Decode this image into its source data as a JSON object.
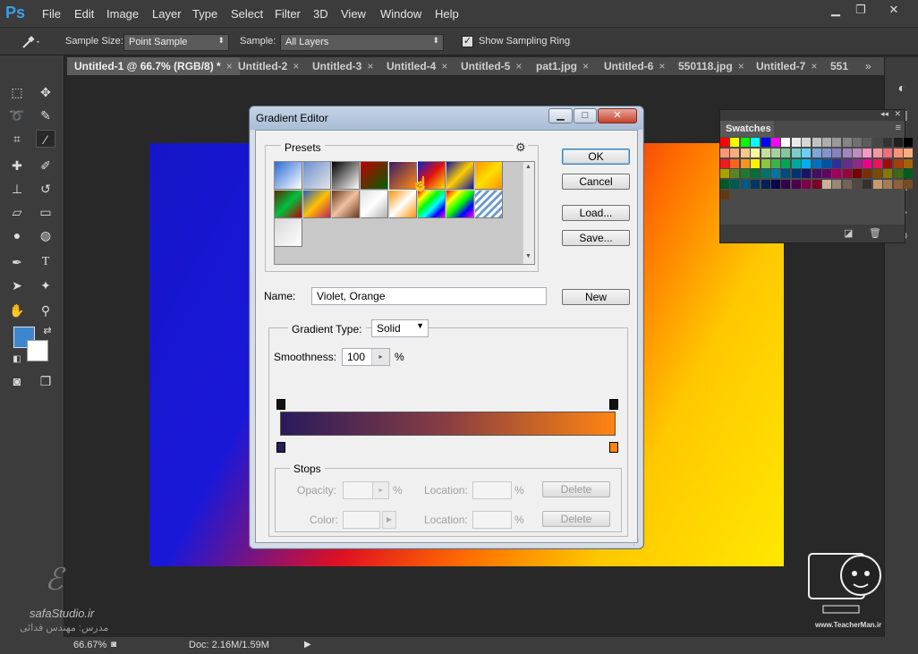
{
  "app": {
    "logo": "Ps"
  },
  "menu": [
    "File",
    "Edit",
    "Image",
    "Layer",
    "Type",
    "Select",
    "Filter",
    "3D",
    "View",
    "Window",
    "Help"
  ],
  "window_controls": {
    "minimize": "▁",
    "restore": "❐",
    "close": "✕"
  },
  "options": {
    "tool_icon": "eyedropper-icon",
    "sample_size_label": "Sample Size:",
    "sample_size_value": "Point Sample",
    "sample_label": "Sample:",
    "sample_value": "All Layers",
    "show_ring_label": "Show Sampling Ring",
    "show_ring_checked": true
  },
  "tabs": [
    {
      "label": "Untitled-1 @ 66.7% (RGB/8) *",
      "close": "×"
    },
    {
      "label": "Untitled-2",
      "close": "×"
    },
    {
      "label": "Untitled-3",
      "close": "×"
    },
    {
      "label": "Untitled-4",
      "close": "×"
    },
    {
      "label": "Untitled-5",
      "close": "×"
    },
    {
      "label": "pat1.jpg",
      "close": "×"
    },
    {
      "label": "Untitled-6",
      "close": "×"
    },
    {
      "label": "550118.jpg",
      "close": "×"
    },
    {
      "label": "Untitled-7",
      "close": "×"
    },
    {
      "label": "551",
      "close": ""
    }
  ],
  "tab_overflow": "»",
  "swatches": {
    "title": "Swatches",
    "colors": [
      "#ff0000",
      "#ffff00",
      "#00ff00",
      "#00ffff",
      "#0000ff",
      "#ff00ff",
      "#ffffff",
      "#ebebeb",
      "#d6d6d6",
      "#c2c2c2",
      "#adadad",
      "#999999",
      "#858585",
      "#707070",
      "#5c5c5c",
      "#474747",
      "#333333",
      "#1f1f1f",
      "#000000",
      "#f7977a",
      "#f9ad81",
      "#fdc68a",
      "#fff79a",
      "#c4df9b",
      "#a3d39c",
      "#82ca9d",
      "#7bcdc8",
      "#6ecff6",
      "#7ea7d8",
      "#8493ca",
      "#8882be",
      "#a187be",
      "#bc8dbf",
      "#f49ac2",
      "#f6989d",
      "#f26d7d",
      "#f69679",
      "#f9ad81",
      "#ed1c24",
      "#f26522",
      "#f7941d",
      "#fff200",
      "#8dc73f",
      "#39b54a",
      "#00a651",
      "#00a99d",
      "#00aeef",
      "#0072bc",
      "#0054a6",
      "#2e3192",
      "#662d91",
      "#92278f",
      "#ec008c",
      "#ed145b",
      "#9e0b0f",
      "#a0410d",
      "#a36209",
      "#aba000",
      "#598527",
      "#1a7b30",
      "#007236",
      "#00746b",
      "#0076a3",
      "#004b80",
      "#003471",
      "#1b1464",
      "#440e62",
      "#630460",
      "#9e005d",
      "#9e0039",
      "#790000",
      "#7b2e00",
      "#7d4900",
      "#827b00",
      "#406618",
      "#005e20",
      "#005826",
      "#005952",
      "#005b7f",
      "#003663",
      "#002157",
      "#0d004c",
      "#32004b",
      "#4b0049",
      "#7b0046",
      "#7a0026",
      "#c7b299",
      "#998675",
      "#736357",
      "#534741",
      "#37302d",
      "#c69c6d",
      "#a67c52",
      "#8c6239",
      "#754c24",
      "#603913"
    ]
  },
  "gradient_editor": {
    "title": "Gradient Editor",
    "controls": {
      "minimize": "▁",
      "maximize": "□",
      "close": "✕"
    },
    "presets_label": "Presets",
    "presets_menu_icon": "gear-icon",
    "preset_swatches": [
      "linear-gradient(135deg,#2a6bd6,#ffffff)",
      "linear-gradient(135deg,#6a8fd0,#e6e6e6)",
      "linear-gradient(135deg,#000000,#ffffff)",
      "linear-gradient(135deg,#c00000,#006000)",
      "linear-gradient(135deg,#3a1a6a,#ff8a10)",
      "linear-gradient(135deg,#1020c0,#e01010,#ffe000)",
      "linear-gradient(135deg,#1010a0,#ffd000,#1010a0)",
      "linear-gradient(135deg,#ff9000,#ffe000,#ff9000)",
      "linear-gradient(135deg,#5a2a00,#00c040,#c00000)",
      "linear-gradient(135deg,#2060c0,#ffc000,#c02060)",
      "linear-gradient(135deg,#6a3a20,#f0c0a0,#6a3a20)",
      "linear-gradient(135deg,#e0e0e0,#ffffff,#b0b0b0)",
      "linear-gradient(135deg,#ff9000,#ffffff,#ff9000)",
      "linear-gradient(135deg,#ff0000,#ffff00,#00ff00,#00ffff,#0000ff,#ff00ff)",
      "linear-gradient(135deg,#ff0000,#ffff00,#00ff00,#0000ff,#ff00ff)",
      "repeating-linear-gradient(135deg,#ffffff 0 3px,#6a9ad0 3px 6px)",
      "linear-gradient(135deg,#d8d8d8,#ffffff)"
    ],
    "buttons": {
      "ok": "OK",
      "cancel": "Cancel",
      "load": "Load...",
      "save": "Save...",
      "new": "New"
    },
    "name_label": "Name:",
    "name_value": "Violet, Orange",
    "gradient_type_label": "Gradient Type:",
    "gradient_type_value": "Solid",
    "smoothness_label": "Smoothness:",
    "smoothness_value": "100",
    "smoothness_unit": "%",
    "gradient_start": "#291a5c",
    "gradient_end": "#ff8410",
    "stops_label": "Stops",
    "opacity_label": "Opacity:",
    "opacity_unit": "%",
    "color_label": "Color:",
    "location_label": "Location:",
    "location_unit": "%",
    "delete_label": "Delete"
  },
  "status": {
    "zoom": "66.67%",
    "doc": "Doc: 2.16M/1.59M"
  },
  "watermark_left": {
    "site": "safaStudio.ir",
    "teacher": "مدرس: مهندس فدائی"
  },
  "watermark_right": {
    "site": "www.TeacherMan.ir",
    "logo_text": "Teacher Man"
  }
}
